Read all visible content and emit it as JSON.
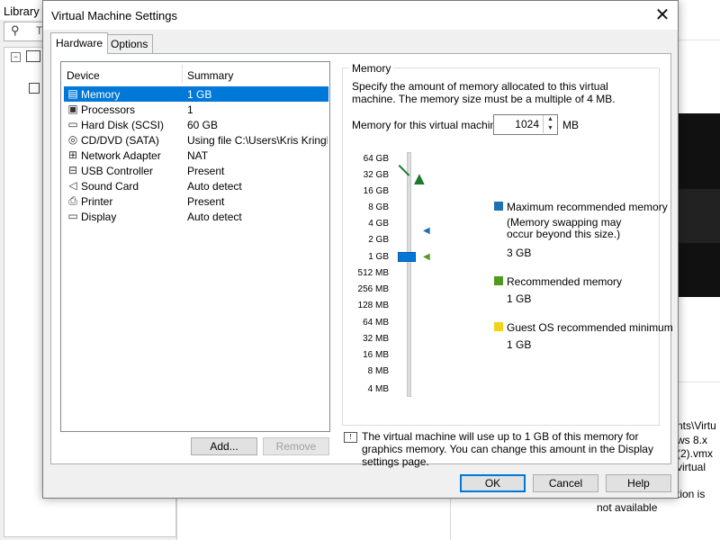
{
  "background": {
    "library_title": "Library",
    "search_text": "T",
    "right_texts": [
      "nts\\Virtu",
      "ws 8.x",
      "(2).vmx",
      "virtual",
      "tion is",
      "not available"
    ]
  },
  "dialog": {
    "title": "Virtual Machine Settings",
    "close": "✕",
    "tabs": {
      "hardware": "Hardware",
      "options": "Options"
    },
    "device_list": {
      "header_device": "Device",
      "header_summary": "Summary",
      "rows": [
        {
          "icon": "▤",
          "name": "Memory",
          "summary": "1 GB"
        },
        {
          "icon": "▣",
          "name": "Processors",
          "summary": "1"
        },
        {
          "icon": "▭",
          "name": "Hard Disk (SCSI)",
          "summary": "60 GB"
        },
        {
          "icon": "◎",
          "name": "CD/DVD (SATA)",
          "summary": "Using file C:\\Users\\Kris Kringl..."
        },
        {
          "icon": "⊞",
          "name": "Network Adapter",
          "summary": "NAT"
        },
        {
          "icon": "⊟",
          "name": "USB Controller",
          "summary": "Present"
        },
        {
          "icon": "◁",
          "name": "Sound Card",
          "summary": "Auto detect"
        },
        {
          "icon": "⎙",
          "name": "Printer",
          "summary": "Present"
        },
        {
          "icon": "▭",
          "name": "Display",
          "summary": "Auto detect"
        }
      ],
      "add_button": "Add...",
      "remove_button": "Remove"
    },
    "memory": {
      "legend": "Memory",
      "description": "Specify the amount of memory allocated to this virtual machine. The memory size must be a multiple of 4 MB.",
      "field_label": "Memory for this virtual machine:",
      "value": "1024",
      "unit": "MB",
      "spin_up": "▲",
      "spin_down": "▼",
      "scale": [
        "64 GB",
        "32 GB",
        "16 GB",
        "8 GB",
        "4 GB",
        "2 GB",
        "1 GB",
        "512 MB",
        "256 MB",
        "128 MB",
        "64 MB",
        "32 MB",
        "16 MB",
        "8 MB",
        "4 MB"
      ],
      "tree_glyph": "▲",
      "max_marker": "◀",
      "rec_marker": "◀",
      "legend_items": {
        "max_title": "Maximum recommended memory",
        "max_note": "(Memory swapping may occur beyond this size.)",
        "max_value": "3 GB",
        "rec_title": "Recommended memory",
        "rec_value": "1 GB",
        "guest_title": "Guest OS recommended minimum",
        "guest_value": "1 GB"
      },
      "colors": {
        "max": "#1f6fb5",
        "rec": "#4f9a1f",
        "guest": "#f2d31b",
        "selection": "#0078d7"
      }
    },
    "info": "The virtual machine will use up to 1 GB of this memory for graphics memory. You can change this amount in the Display settings page.",
    "buttons": {
      "ok": "OK",
      "cancel": "Cancel",
      "help": "Help"
    }
  }
}
